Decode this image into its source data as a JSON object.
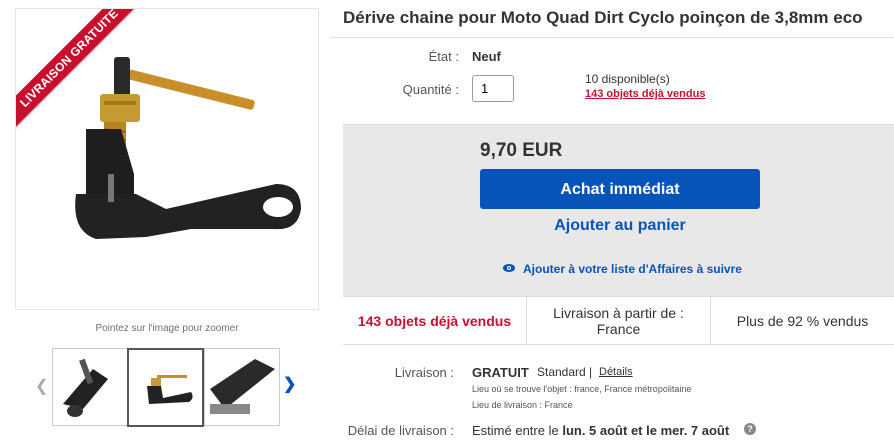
{
  "image_panel": {
    "ribbon_text": "LIVRAISON GRATUITE",
    "zoom_hint": "Pointez sur l'image pour zoomer"
  },
  "listing": {
    "title": "Dérive chaine pour Moto Quad Dirt Cyclo poinçon de 3,8mm eco",
    "condition_label": "État :",
    "condition_value": "Neuf",
    "quantity_label": "Quantité :",
    "quantity_value": "1",
    "available": "10 disponible(s)",
    "sold_link": "143 objets déjà vendus"
  },
  "buy_box": {
    "price": "9,70 EUR",
    "buy_now": "Achat immédiat",
    "add_to_cart": "Ajouter au panier",
    "watch": "Ajouter à votre liste d'Affaires à suivre"
  },
  "stats": {
    "sold": "143 objets déjà vendus",
    "ships_from": "Livraison à partir de : France",
    "positive": "Plus de 92 % vendus"
  },
  "shipping": {
    "label": "Livraison :",
    "free": "GRATUIT",
    "standard": "Standard |",
    "details": "Détails",
    "item_location": "Lieu où se trouve l'objet : france, France métropolitaine",
    "ship_to": "Lieu de livraison : France",
    "delay_label": "Délai de livraison :",
    "delay_prefix": "Estimé entre le ",
    "delay_bold": "lun. 5 août et le mer. 7 août"
  },
  "colors": {
    "accent": "#0654ba",
    "ribbon": "#c8102e",
    "sold": "#c8102e"
  }
}
